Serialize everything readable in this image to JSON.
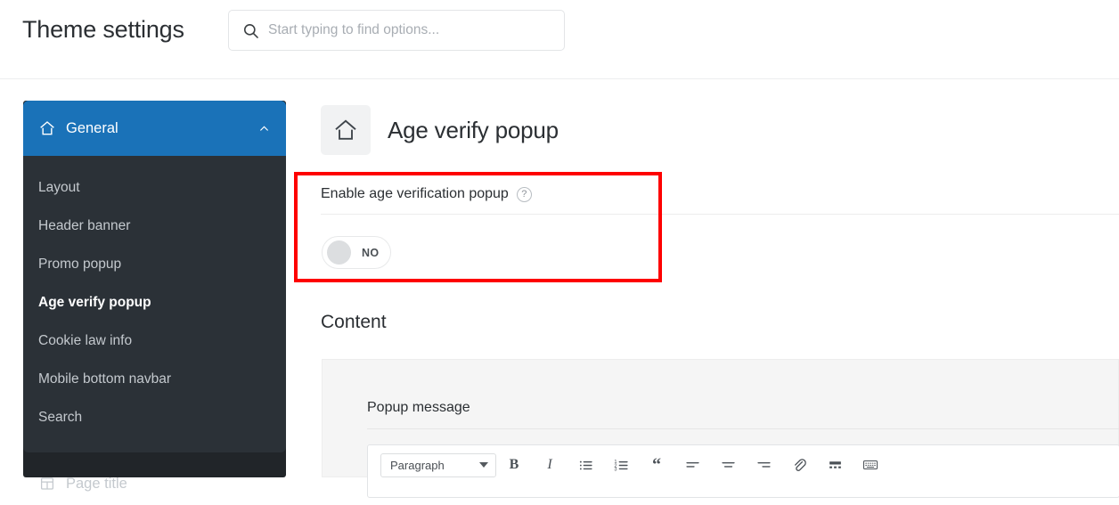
{
  "header": {
    "title": "Theme settings",
    "search": {
      "placeholder": "Start typing to find options...",
      "value": "",
      "icon": "search-icon"
    }
  },
  "sidebar": {
    "group": {
      "label": "General",
      "icon": "home-icon",
      "expanded_icon": "chevron-up-icon",
      "items": [
        {
          "label": "Layout",
          "active": false
        },
        {
          "label": "Header banner",
          "active": false
        },
        {
          "label": "Promo popup",
          "active": false
        },
        {
          "label": "Age verify popup",
          "active": true
        },
        {
          "label": "Cookie law info",
          "active": false
        },
        {
          "label": "Mobile bottom navbar",
          "active": false
        },
        {
          "label": "Search",
          "active": false
        }
      ]
    },
    "bottom_item": {
      "label": "Page title",
      "icon": "page-icon"
    }
  },
  "main": {
    "section": {
      "icon": "home-icon",
      "title": "Age verify popup"
    },
    "enable_field": {
      "label": "Enable age verification popup",
      "help_icon": "question-mark-icon",
      "help_glyph": "?",
      "toggle_state": "NO",
      "toggle_on": false
    },
    "content_section": {
      "heading": "Content",
      "popup_message": {
        "label": "Popup message",
        "editor": {
          "format_select": "Paragraph",
          "caret_icon": "chevron-down-icon",
          "buttons": [
            {
              "name": "bold-button",
              "glyph": "B",
              "style": "b"
            },
            {
              "name": "italic-button",
              "glyph": "I",
              "style": "i"
            },
            {
              "name": "bullet-list-button",
              "glyph": "",
              "style": "svg-ul"
            },
            {
              "name": "numbered-list-button",
              "glyph": "",
              "style": "svg-ol"
            },
            {
              "name": "blockquote-button",
              "glyph": "“",
              "style": "q"
            },
            {
              "name": "align-left-button",
              "glyph": "",
              "style": "svg-al"
            },
            {
              "name": "align-center-button",
              "glyph": "",
              "style": "svg-ac"
            },
            {
              "name": "align-right-button",
              "glyph": "",
              "style": "svg-ar"
            },
            {
              "name": "link-button",
              "glyph": "",
              "style": "svg-link"
            },
            {
              "name": "insert-more-button",
              "glyph": "",
              "style": "svg-more"
            },
            {
              "name": "keyboard-shortcuts-button",
              "glyph": "",
              "style": "svg-kbd"
            }
          ]
        }
      }
    }
  },
  "colors": {
    "accent_blue": "#1a72b8",
    "sidebar_dark": "#212529",
    "sidebar_panel": "#2b3137",
    "highlight_red": "#fe0000",
    "card_bg": "#f5f5f5"
  }
}
